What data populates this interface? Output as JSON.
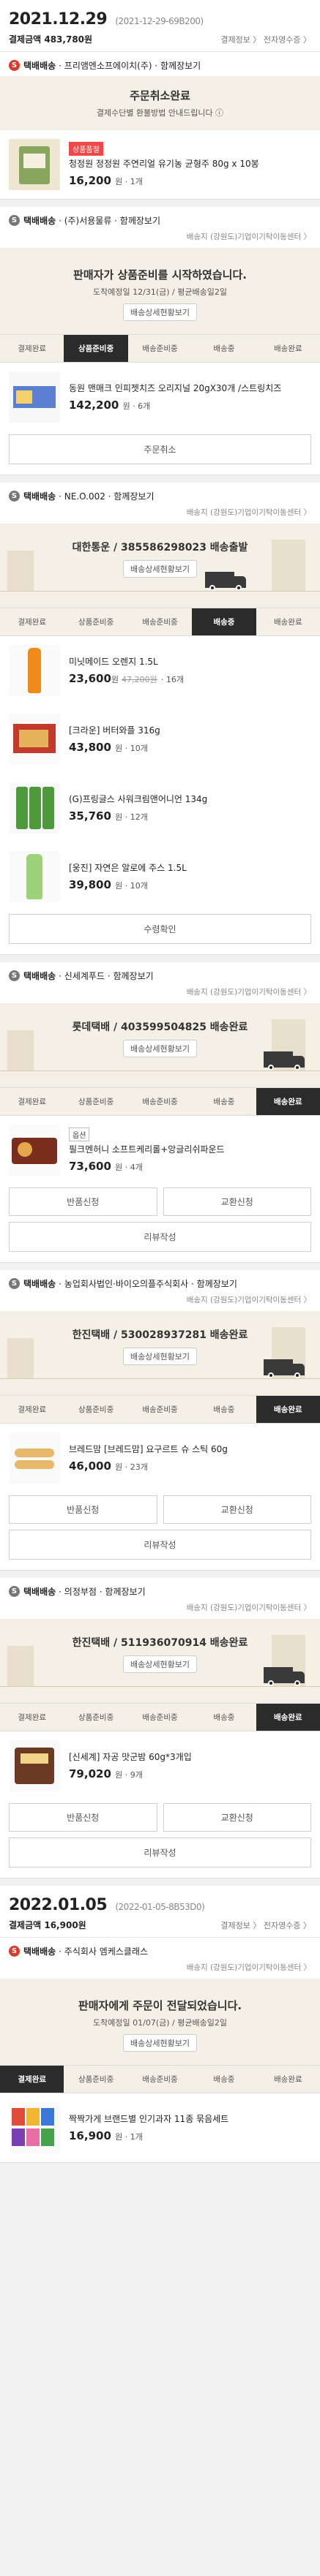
{
  "days": [
    {
      "date": "2021.12.29",
      "order_no": "(2021-12-29-69B200)",
      "pay_label": "결제금액",
      "pay_amount": "483,780원",
      "links": "결제정보 〉 전자영수증 〉"
    },
    {
      "date": "2022.01.05",
      "order_no": "(2022-01-05-8B53D0)",
      "pay_label": "결제금액",
      "pay_amount": "16,900원",
      "links": "결제정보 〉 전자영수증 〉"
    }
  ],
  "steps": [
    "결제완료",
    "상품준비중",
    "배송준비중",
    "배송중",
    "배송완료"
  ],
  "orders": [
    {
      "badge": "S",
      "ship_label": "택배배송",
      "seller": "· 프리앰엔소프에이치(주) · 함께장보기",
      "status_title": "주문취소완료",
      "status_sub": "결제수단별 환불방법 안내드립니다 ⓘ",
      "items": [
        {
          "tag": "상품품절",
          "name": "청정원 정정원 주연리얼 유기농 균형주 80g x 10봉",
          "price": "16,200",
          "count": "원 · 1개"
        }
      ]
    },
    {
      "badge": "S",
      "ship_label": "택배배송",
      "seller": "· (주)서용물류 · 함께장보기",
      "arrive": "배송지 (강원도)기업이기탁이동센터 〉",
      "status_title": "판매자가 상품준비를 시작하였습니다.",
      "status_sub": "도착예정일 12/31(금) / 평균배송일2일",
      "track": "배송상세현황보기",
      "items": [
        {
          "name": "동원 맨매크 인피젯치즈 오리지널 20gX30개 /스트링치즈",
          "price": "142,200",
          "count": "원 · 6개"
        }
      ],
      "button": "주문취소"
    },
    {
      "badge": "S",
      "ship_label": "택배배송",
      "seller": "· NE.O.002 · 함께장보기",
      "arrive": "배송지 (강원도)기업이기탁이동센터 〉",
      "status_title": "대한통운 / 385586298023 배송출발",
      "track": "배송상세현황보기",
      "items": [
        {
          "name": "미닛메이드 오렌지 1.5L",
          "price": "23,600",
          "old": "47,200원",
          "count": "· 16개"
        },
        {
          "name": "[크라운] 버터와플 316g",
          "price": "43,800",
          "count": "원 · 10개"
        },
        {
          "name": "(G)프링글스 사워크림앤어니언 134g",
          "price": "35,760",
          "count": "원 · 12개"
        },
        {
          "name": "[웅진] 자연은 알로에 주스 1.5L",
          "price": "39,800",
          "count": "원 · 10개"
        }
      ],
      "button": "수령확인"
    },
    {
      "badge": "S",
      "ship_label": "택배배송",
      "seller": "· 신세계푸드 · 함께장보기",
      "arrive": "배송지 (강원도)기업이기탁이동센터 〉",
      "status_title": "롯데택배 / 403599504825 배송완료",
      "track": "배송상세현황보기",
      "items": [
        {
          "tag": "옵션",
          "name": "필크멘허니 소프트케리롤+앙글리쉬파운드",
          "price": "73,600",
          "count": "원 · 4개"
        }
      ],
      "buttons": [
        "반품신청",
        "교환신청"
      ],
      "review": "리뷰작성"
    },
    {
      "badge": "S",
      "ship_label": "택배배송",
      "seller": "· 농업회사법인·바이오의플주식회사 · 함께장보기",
      "arrive": "배송지 (강원도)기업이기탁이동센터 〉",
      "status_title": "한진택배 / 530028937281 배송완료",
      "track": "배송상세현황보기",
      "items": [
        {
          "name": "브레드맘 [브레드맘] 요구르트 슈 스틱 60g",
          "price": "46,000",
          "count": "원 · 23개"
        }
      ],
      "buttons": [
        "반품신청",
        "교환신청"
      ],
      "review": "리뷰작성"
    },
    {
      "badge": "S",
      "ship_label": "택배배송",
      "seller": "· 의정부점 · 함께장보기",
      "arrive": "배송지 (강원도)기업이기탁이동센터 〉",
      "status_title": "한진택배 / 511936070914 배송완료",
      "track": "배송상세현황보기",
      "items": [
        {
          "name": "[신세계] 자공 맛군밤 60g*3개입",
          "price": "79,020",
          "count": "원 · 9개"
        }
      ],
      "buttons": [
        "반품신청",
        "교환신청"
      ],
      "review": "리뷰작성"
    },
    {
      "badge": "S",
      "ship_label": "택배배송",
      "seller": "· 주식회사 엠케스클래스",
      "arrive": "배송지 (강원도)기업이기탁이동센터 〉",
      "status_title": "판매자에게 주문이 전달되었습니다.",
      "status_sub": "도착예정일 01/07(금) / 평균배송일2일",
      "track": "배송상세현황보기",
      "items": [
        {
          "name": "짝짝가게 브랜드별 인기과자 11종 묶음세트",
          "price": "16,900",
          "count": "원 · 1개"
        }
      ]
    }
  ]
}
